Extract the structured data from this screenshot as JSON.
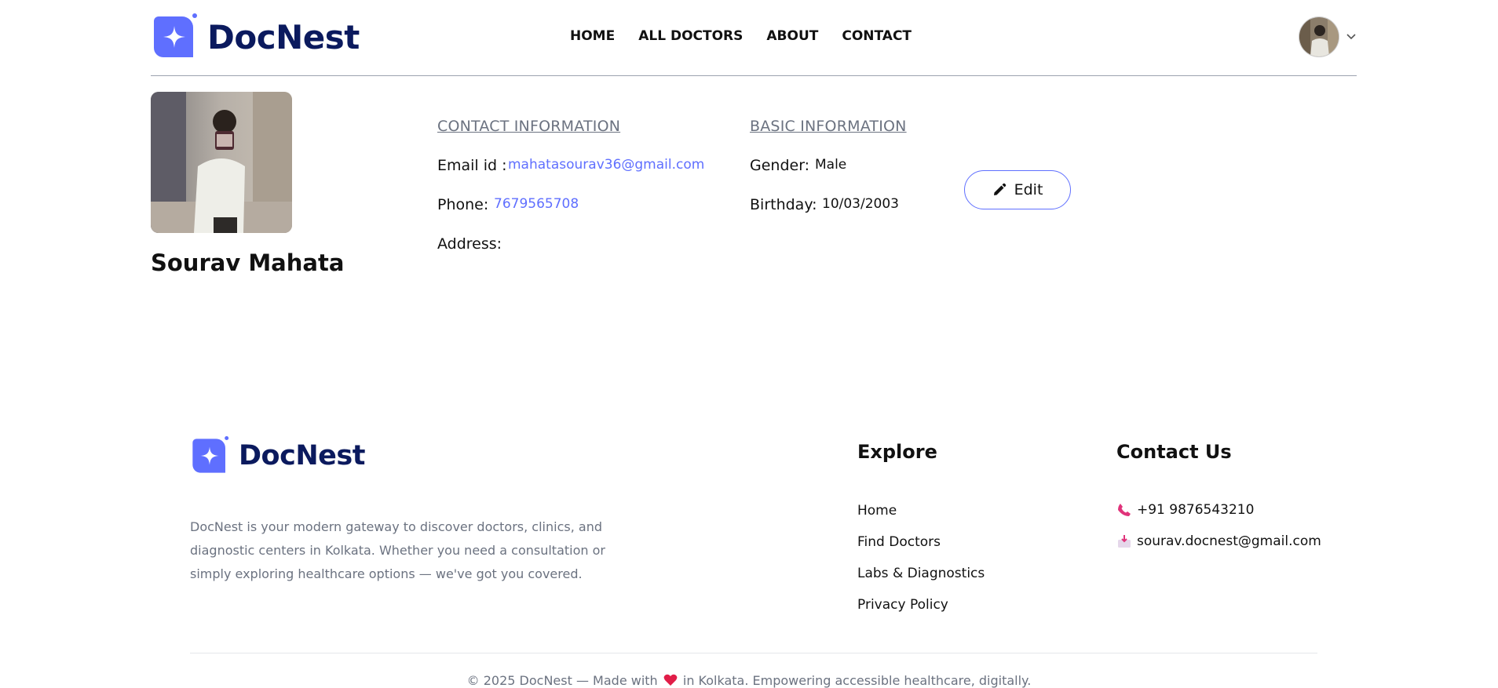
{
  "brand": {
    "name": "DocNest",
    "color": "#5f6fff",
    "text_color": "#0b1a5e"
  },
  "nav": {
    "items": [
      "HOME",
      "ALL DOCTORS",
      "ABOUT",
      "CONTACT"
    ]
  },
  "user_menu": {
    "avatar": "user-avatar",
    "chevron": "chevron-down-icon"
  },
  "profile": {
    "name": "Sourav Mahata",
    "contact": {
      "title": "CONTACT INFORMATION",
      "email_label": "Email id :",
      "email": "mahatasourav36@gmail.com",
      "phone_label": "Phone:",
      "phone": "7679565708",
      "address_label": "Address:"
    },
    "basic": {
      "title": "BASIC INFORMATION",
      "gender_label": "Gender:",
      "gender": "Male",
      "birthday_label": "Birthday:",
      "birthday": "10/03/2003"
    },
    "edit_label": "Edit"
  },
  "footer": {
    "brand": "DocNest",
    "description": "DocNest is your modern gateway to discover doctors, clinics, and diagnostic centers in Kolkata. Whether you need a consultation or simply exploring healthcare options — we've got you covered.",
    "explore_title": "Explore",
    "explore_links": [
      "Home",
      "Find Doctors",
      "Labs & Diagnostics",
      "Privacy Policy"
    ],
    "contact_title": "Contact Us",
    "phone": "+91 9876543210",
    "email": "sourav.docnest@gmail.com",
    "copyright_before": "© 2025 DocNest — Made with",
    "copyright_after": "in Kolkata. Empowering accessible healthcare, digitally."
  }
}
